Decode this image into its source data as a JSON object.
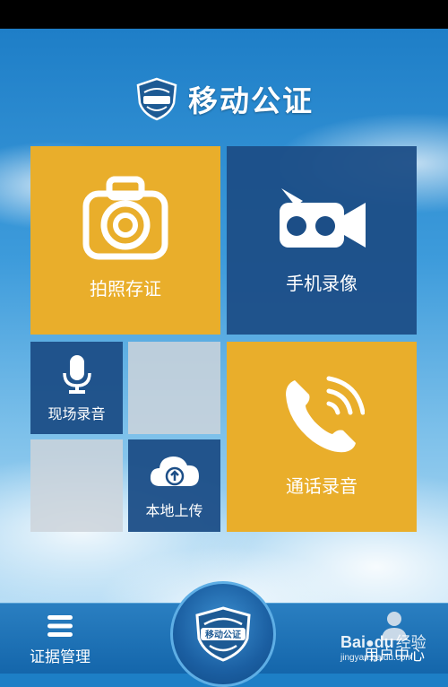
{
  "app": {
    "title": "移动公证",
    "logo_text": "移动公证"
  },
  "tiles": {
    "photo": {
      "label": "拍照存证",
      "icon": "camera-icon"
    },
    "video": {
      "label": "手机录像",
      "icon": "video-camera-icon"
    },
    "field_audio": {
      "label": "现场录音",
      "icon": "microphone-icon"
    },
    "local_upload": {
      "label": "本地上传",
      "icon": "cloud-upload-icon"
    },
    "call_record": {
      "label": "通话录音",
      "icon": "phone-icon"
    }
  },
  "bottom_nav": {
    "left": {
      "label": "证据管理",
      "icon": "menu-icon"
    },
    "right": {
      "label": "用户中心",
      "icon": "user-icon"
    }
  },
  "watermark": {
    "brand": "Bai",
    "paw": "du",
    "product": "经验",
    "url": "jingyan.baidu.com"
  },
  "colors": {
    "gold": "#e9ae2b",
    "navy": "#1c4e87",
    "sky": "#1e7ec7"
  }
}
